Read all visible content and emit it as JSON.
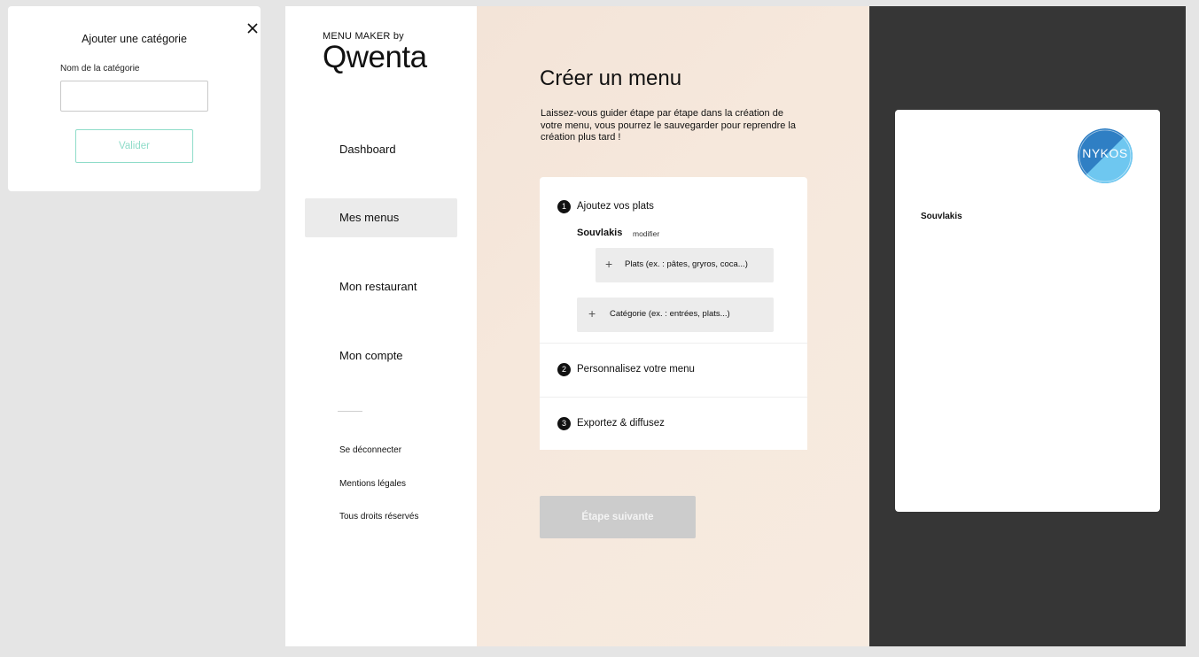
{
  "modal": {
    "title": "Ajouter une catégorie",
    "field_label": "Nom de la catégorie",
    "field_value": "",
    "field_placeholder": "",
    "submit_label": "Valider"
  },
  "brand": {
    "small": "MENU MAKER by",
    "logo": "Qwenta"
  },
  "sidebar": {
    "items": [
      {
        "label": "Dashboard",
        "active": false
      },
      {
        "label": "Mes menus",
        "active": true
      },
      {
        "label": "Mon restaurant",
        "active": false
      },
      {
        "label": "Mon compte",
        "active": false
      }
    ],
    "footer": [
      "Se déconnecter",
      "Mentions légales",
      "Tous droits réservés"
    ]
  },
  "main": {
    "title": "Créer un menu",
    "intro": "Laissez-vous guider étape par étape dans la création de votre menu, vous pourrez le sauvegarder pour reprendre la création plus tard !",
    "steps": [
      {
        "number": "1",
        "title": "Ajoutez vos plats"
      },
      {
        "number": "2",
        "title": "Personnalisez votre menu"
      },
      {
        "number": "3",
        "title": "Exportez & diffusez"
      }
    ],
    "category": {
      "name": "Souvlakis",
      "edit_label": "modifier"
    },
    "add_dish_label": "Plats (ex. : pâtes, gryros, coca...)",
    "add_category_label": "Catégorie (ex. : entrées, plats...)",
    "next_label": "Étape suivante"
  },
  "preview": {
    "logo_text": "NYKOS",
    "category": "Souvlakis"
  },
  "colors": {
    "accent_teal": "#8fdcc9",
    "preview_bg": "#363636",
    "logo_dark": "#2f7fc4",
    "logo_light": "#6ec7f0"
  }
}
